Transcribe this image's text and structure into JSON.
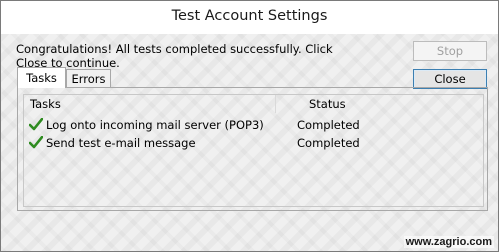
{
  "window": {
    "title": "Test Account Settings"
  },
  "message": "Congratulations! All tests completed successfully. Click Close to continue.",
  "buttons": {
    "stop": "Stop",
    "close": "Close"
  },
  "tabs": [
    {
      "label": "Tasks",
      "selected": true
    },
    {
      "label": "Errors",
      "selected": false
    }
  ],
  "table": {
    "columns": [
      "Tasks",
      "Status"
    ],
    "rows": [
      {
        "task": "Log onto incoming mail server (POP3)",
        "status": "Completed",
        "icon": "checkmark-icon"
      },
      {
        "task": "Send test e-mail message",
        "status": "Completed",
        "icon": "checkmark-icon"
      }
    ]
  },
  "watermark": "www.zagrio.com",
  "colors": {
    "checkmark": "#2e8b20",
    "accent": "#3c7fb1"
  }
}
